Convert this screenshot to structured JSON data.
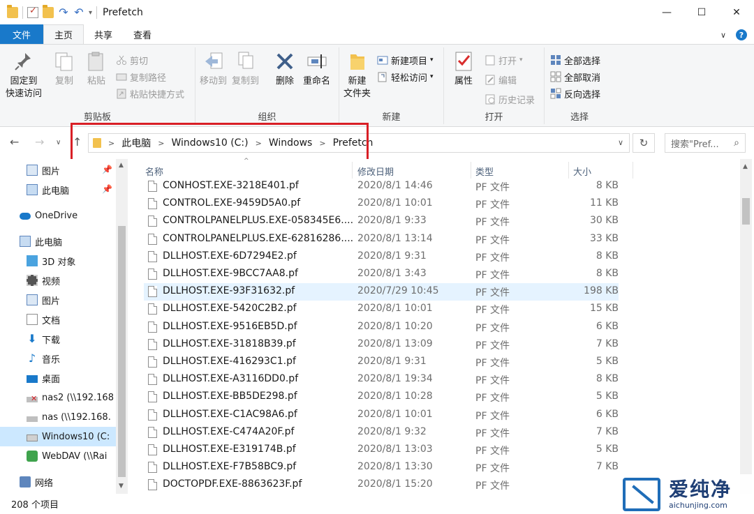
{
  "window": {
    "title": "Prefetch",
    "minimize_glyph": "—",
    "maximize_glyph": "☐",
    "close_glyph": "✕"
  },
  "tabs": [
    {
      "label": "文件"
    },
    {
      "label": "主页"
    },
    {
      "label": "共享"
    },
    {
      "label": "查看"
    }
  ],
  "ribbon": {
    "clipboard": {
      "group_label": "剪贴板",
      "pin_label_1": "固定到",
      "pin_label_2": "快速访问",
      "copy_label": "复制",
      "paste_label": "粘贴",
      "cut_label": "剪切",
      "copy_path_label": "复制路径",
      "paste_shortcut_label": "粘贴快捷方式"
    },
    "organize": {
      "group_label": "组织",
      "move_to_label": "移动到",
      "copy_to_label": "复制到",
      "delete_label": "删除",
      "rename_label": "重命名"
    },
    "new": {
      "group_label": "新建",
      "new_folder_label_1": "新建",
      "new_folder_label_2": "文件夹",
      "new_item_label": "新建项目",
      "easy_access_label": "轻松访问"
    },
    "open": {
      "group_label": "打开",
      "properties_label": "属性",
      "open_label": "打开",
      "edit_label": "编辑",
      "history_label": "历史记录"
    },
    "select": {
      "group_label": "选择",
      "select_all_label": "全部选择",
      "select_none_label": "全部取消",
      "invert_label": "反向选择"
    }
  },
  "address": {
    "crumbs": [
      "此电脑",
      "Windows10 (C:)",
      "Windows",
      "Prefetch"
    ],
    "search_placeholder": "搜索\"Pref..."
  },
  "nav": {
    "items": [
      {
        "label": "图片",
        "icon": "pictures-icon"
      },
      {
        "label": "此电脑",
        "icon": "computer-icon"
      },
      {
        "label": "OneDrive",
        "icon": "onedrive-icon"
      },
      {
        "label": "此电脑",
        "icon": "computer-icon"
      },
      {
        "label": "3D 对象",
        "icon": "3d-objects-icon"
      },
      {
        "label": "视频",
        "icon": "video-icon"
      },
      {
        "label": "图片",
        "icon": "pictures-icon"
      },
      {
        "label": "文档",
        "icon": "documents-icon"
      },
      {
        "label": "下载",
        "icon": "download-icon"
      },
      {
        "label": "音乐",
        "icon": "music-icon"
      },
      {
        "label": "桌面",
        "icon": "desktop-icon"
      },
      {
        "label": "nas2 (\\\\192.168",
        "icon": "network-drive-disconnected-icon"
      },
      {
        "label": "nas (\\\\192.168.",
        "icon": "network-drive-icon"
      },
      {
        "label": "Windows10 (C:",
        "icon": "drive-icon"
      },
      {
        "label": "WebDAV (\\\\Rai",
        "icon": "webdav-icon"
      },
      {
        "label": "网络",
        "icon": "network-icon"
      }
    ]
  },
  "columns": {
    "name": "名称",
    "date": "修改日期",
    "type": "类型",
    "size": "大小"
  },
  "files": [
    {
      "name": "CONHOST.EXE-3218E401.pf",
      "date": "2020/8/1 14:46",
      "type": "PF 文件",
      "size": "8 KB"
    },
    {
      "name": "CONTROL.EXE-9459D5A0.pf",
      "date": "2020/8/1 10:01",
      "type": "PF 文件",
      "size": "11 KB"
    },
    {
      "name": "CONTROLPANELPLUS.EXE-058345E6....",
      "date": "2020/8/1 9:33",
      "type": "PF 文件",
      "size": "30 KB"
    },
    {
      "name": "CONTROLPANELPLUS.EXE-62816286....",
      "date": "2020/8/1 13:14",
      "type": "PF 文件",
      "size": "33 KB"
    },
    {
      "name": "DLLHOST.EXE-6D7294E2.pf",
      "date": "2020/8/1 9:31",
      "type": "PF 文件",
      "size": "8 KB"
    },
    {
      "name": "DLLHOST.EXE-9BCC7AA8.pf",
      "date": "2020/8/1 3:43",
      "type": "PF 文件",
      "size": "8 KB"
    },
    {
      "name": "DLLHOST.EXE-93F31632.pf",
      "date": "2020/7/29 10:45",
      "type": "PF 文件",
      "size": "198 KB"
    },
    {
      "name": "DLLHOST.EXE-5420C2B2.pf",
      "date": "2020/8/1 10:01",
      "type": "PF 文件",
      "size": "15 KB"
    },
    {
      "name": "DLLHOST.EXE-9516EB5D.pf",
      "date": "2020/8/1 10:20",
      "type": "PF 文件",
      "size": "6 KB"
    },
    {
      "name": "DLLHOST.EXE-31818B39.pf",
      "date": "2020/8/1 13:09",
      "type": "PF 文件",
      "size": "7 KB"
    },
    {
      "name": "DLLHOST.EXE-416293C1.pf",
      "date": "2020/8/1 9:31",
      "type": "PF 文件",
      "size": "5 KB"
    },
    {
      "name": "DLLHOST.EXE-A3116DD0.pf",
      "date": "2020/8/1 19:34",
      "type": "PF 文件",
      "size": "8 KB"
    },
    {
      "name": "DLLHOST.EXE-BB5DE298.pf",
      "date": "2020/8/1 10:28",
      "type": "PF 文件",
      "size": "5 KB"
    },
    {
      "name": "DLLHOST.EXE-C1AC98A6.pf",
      "date": "2020/8/1 10:01",
      "type": "PF 文件",
      "size": "6 KB"
    },
    {
      "name": "DLLHOST.EXE-C474A20F.pf",
      "date": "2020/8/1 9:32",
      "type": "PF 文件",
      "size": "7 KB"
    },
    {
      "name": "DLLHOST.EXE-E319174B.pf",
      "date": "2020/8/1 13:03",
      "type": "PF 文件",
      "size": "5 KB"
    },
    {
      "name": "DLLHOST.EXE-F7B58BC9.pf",
      "date": "2020/8/1 13:30",
      "type": "PF 文件",
      "size": "7 KB"
    },
    {
      "name": "DOCTOPDF.EXE-8863623F.pf",
      "date": "2020/8/1 15:20",
      "type": "PF 文件",
      "size": ""
    }
  ],
  "status": {
    "count_text": "208 个项目"
  },
  "watermark": {
    "cn": "爱纯净",
    "en": "aichunjing.com"
  },
  "colors": {
    "accent": "#1979ca",
    "highlight_box": "#d91f26",
    "selection": "#cce8ff",
    "hover_row": "#e5f3ff"
  }
}
